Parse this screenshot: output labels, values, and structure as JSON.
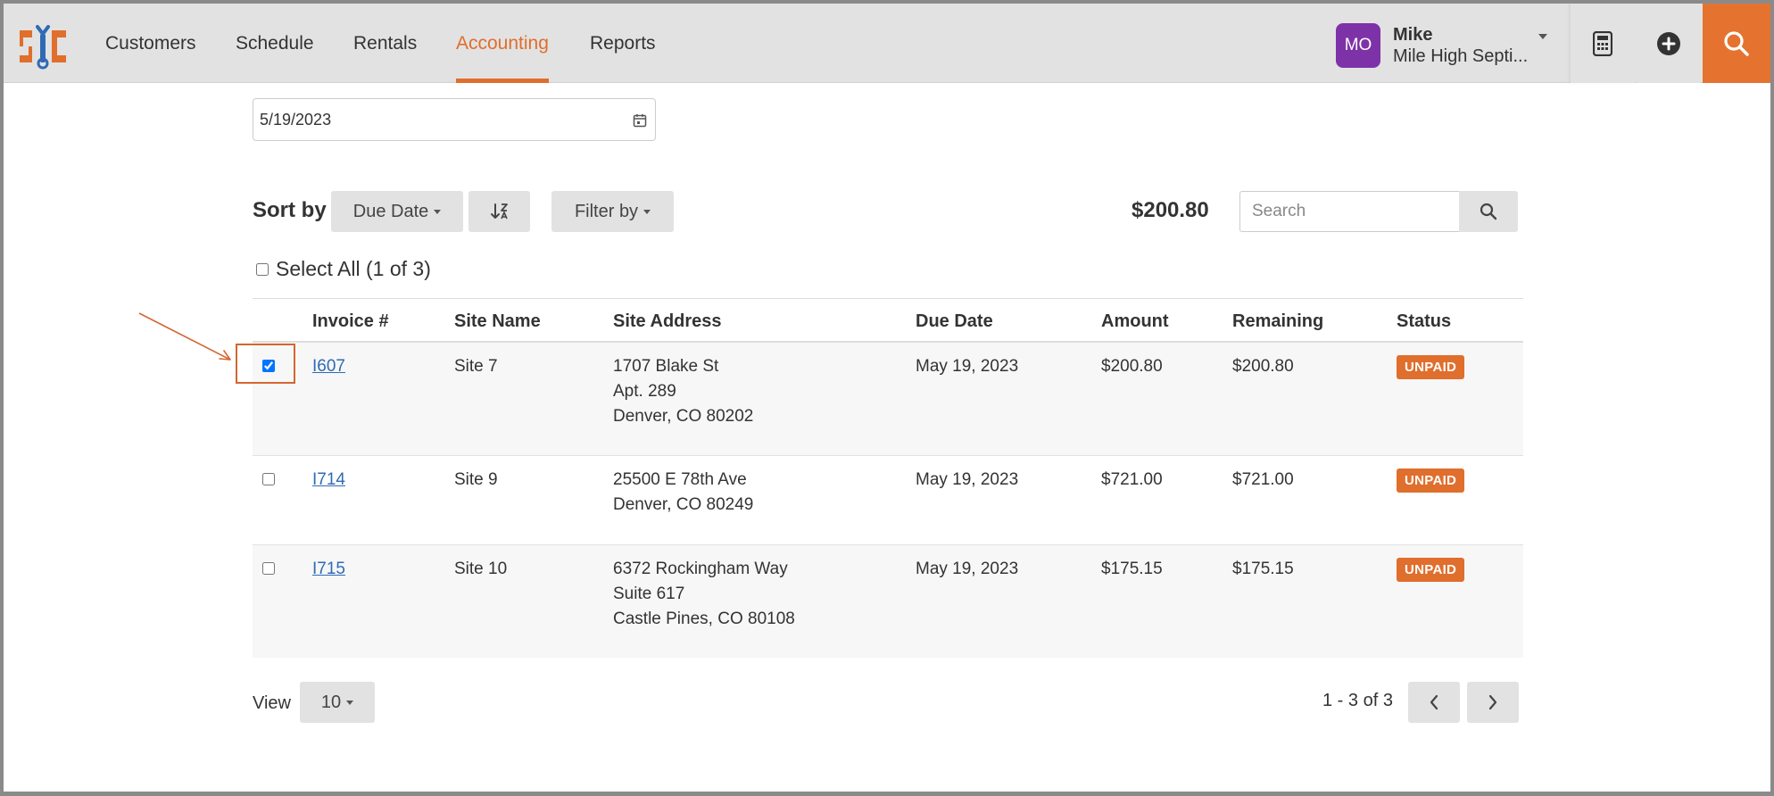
{
  "nav": {
    "items": [
      {
        "label": "Customers",
        "active": false
      },
      {
        "label": "Schedule",
        "active": false
      },
      {
        "label": "Rentals",
        "active": false
      },
      {
        "label": "Accounting",
        "active": true
      },
      {
        "label": "Reports",
        "active": false
      }
    ],
    "user": {
      "initials": "MO",
      "name": "Mike",
      "company": "Mile High Septi..."
    },
    "colors": {
      "accent": "#e06e2c",
      "avatar": "#7e32a8",
      "search_button": "#e5732f"
    }
  },
  "filters": {
    "date_value": "5/19/2023",
    "sort_label": "Sort by",
    "sort_value": "Due Date",
    "filter_label": "Filter by",
    "total": "$200.80",
    "search_placeholder": "Search",
    "select_all_label": "Select All (1 of 3)"
  },
  "table": {
    "headers": {
      "invoice": "Invoice #",
      "site_name": "Site Name",
      "site_address": "Site Address",
      "due_date": "Due Date",
      "amount": "Amount",
      "remaining": "Remaining",
      "status": "Status"
    },
    "rows": [
      {
        "checked": true,
        "invoice": "I607",
        "site": "Site 7",
        "address": [
          "1707 Blake St",
          "Apt. 289",
          "Denver, CO 80202"
        ],
        "due": "May 19, 2023",
        "amount": "$200.80",
        "remaining": "$200.80",
        "status": "UNPAID"
      },
      {
        "checked": false,
        "invoice": "I714",
        "site": "Site 9",
        "address": [
          "25500 E 78th Ave",
          "Denver, CO 80249"
        ],
        "due": "May 19, 2023",
        "amount": "$721.00",
        "remaining": "$721.00",
        "status": "UNPAID"
      },
      {
        "checked": false,
        "invoice": "I715",
        "site": "Site 10",
        "address": [
          "6372 Rockingham Way",
          "Suite 617",
          "Castle Pines, CO 80108"
        ],
        "due": "May 19, 2023",
        "amount": "$175.15",
        "remaining": "$175.15",
        "status": "UNPAID"
      }
    ]
  },
  "footer": {
    "view_label": "View",
    "view_value": "10",
    "page_info": "1 - 3 of 3"
  }
}
